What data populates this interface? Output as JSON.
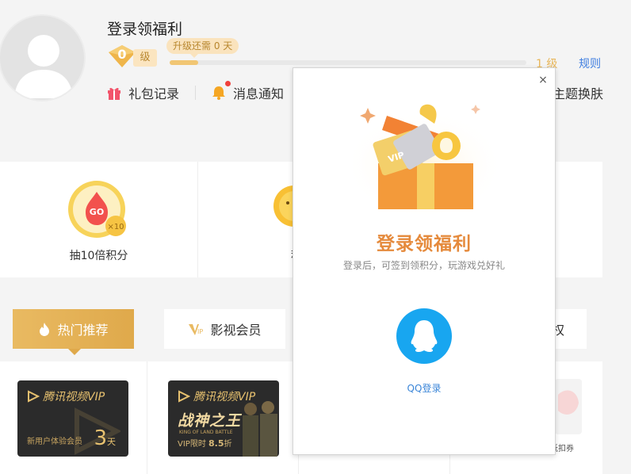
{
  "user": {
    "title": "登录领福利",
    "level": "0",
    "level_suffix": "级",
    "upgrade_tip": "升级还需 0 天",
    "progress": 0.08,
    "next_level": "1 级",
    "rules": "规则"
  },
  "actions": {
    "gift_records": "礼包记录",
    "notifications": "消息通知",
    "theme": "主题换肤"
  },
  "tasks": [
    {
      "label": "抽10倍积分",
      "wheel_badge": "GO",
      "wheel_multiplier": "×10"
    },
    {
      "label": "积分"
    }
  ],
  "tabs": {
    "hot": "热门推荐",
    "video": "影视会员",
    "partial": "权"
  },
  "cards": [
    {
      "brand": "腾讯视频VIP",
      "sub": "新用户体验会员",
      "days": "3",
      "days_unit": "天"
    },
    {
      "brand": "腾讯视频VIP",
      "headline": "战神之王",
      "headline_en": "KING OF LAND BATTLE",
      "limit_prefix": "VIP限时",
      "limit_value": "8.5",
      "limit_suffix": "折"
    }
  ],
  "peek_coupon": "抵扣券",
  "modal": {
    "close": "×",
    "title": "登录领福利",
    "subtitle": "登录后，可签到领积分，玩游戏兑好礼",
    "qq_label": "QQ登录",
    "vip_tag": "VIP"
  },
  "colors": {
    "gold": "#e9ba62",
    "title_orange": "#e58a3c",
    "qq_blue": "#18a6f0",
    "link_blue": "#3f7ee0"
  }
}
